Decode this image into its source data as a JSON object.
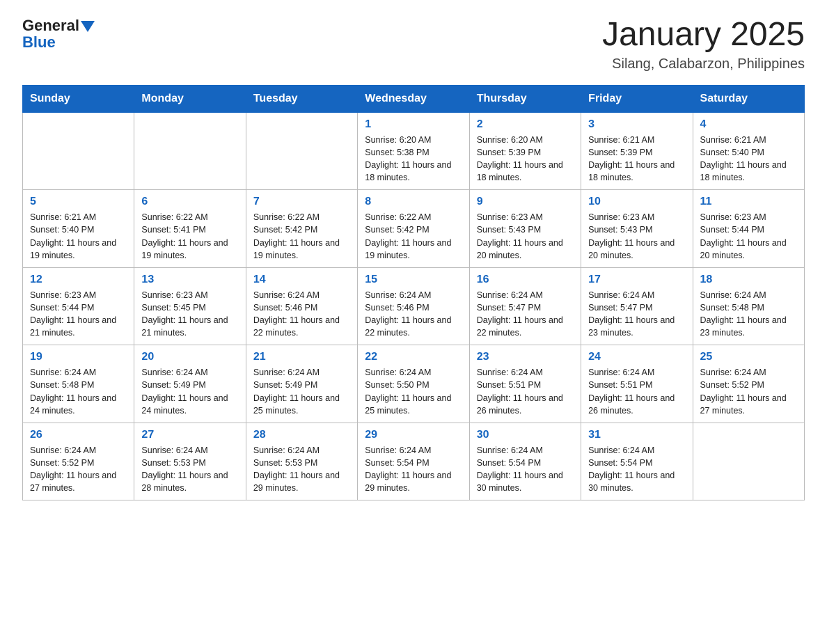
{
  "header": {
    "title": "January 2025",
    "subtitle": "Silang, Calabarzon, Philippines",
    "logo_general": "General",
    "logo_blue": "Blue"
  },
  "days_of_week": [
    "Sunday",
    "Monday",
    "Tuesday",
    "Wednesday",
    "Thursday",
    "Friday",
    "Saturday"
  ],
  "weeks": [
    [
      {
        "day": "",
        "sunrise": "",
        "sunset": "",
        "daylight": ""
      },
      {
        "day": "",
        "sunrise": "",
        "sunset": "",
        "daylight": ""
      },
      {
        "day": "",
        "sunrise": "",
        "sunset": "",
        "daylight": ""
      },
      {
        "day": "1",
        "sunrise": "Sunrise: 6:20 AM",
        "sunset": "Sunset: 5:38 PM",
        "daylight": "Daylight: 11 hours and 18 minutes."
      },
      {
        "day": "2",
        "sunrise": "Sunrise: 6:20 AM",
        "sunset": "Sunset: 5:39 PM",
        "daylight": "Daylight: 11 hours and 18 minutes."
      },
      {
        "day": "3",
        "sunrise": "Sunrise: 6:21 AM",
        "sunset": "Sunset: 5:39 PM",
        "daylight": "Daylight: 11 hours and 18 minutes."
      },
      {
        "day": "4",
        "sunrise": "Sunrise: 6:21 AM",
        "sunset": "Sunset: 5:40 PM",
        "daylight": "Daylight: 11 hours and 18 minutes."
      }
    ],
    [
      {
        "day": "5",
        "sunrise": "Sunrise: 6:21 AM",
        "sunset": "Sunset: 5:40 PM",
        "daylight": "Daylight: 11 hours and 19 minutes."
      },
      {
        "day": "6",
        "sunrise": "Sunrise: 6:22 AM",
        "sunset": "Sunset: 5:41 PM",
        "daylight": "Daylight: 11 hours and 19 minutes."
      },
      {
        "day": "7",
        "sunrise": "Sunrise: 6:22 AM",
        "sunset": "Sunset: 5:42 PM",
        "daylight": "Daylight: 11 hours and 19 minutes."
      },
      {
        "day": "8",
        "sunrise": "Sunrise: 6:22 AM",
        "sunset": "Sunset: 5:42 PM",
        "daylight": "Daylight: 11 hours and 19 minutes."
      },
      {
        "day": "9",
        "sunrise": "Sunrise: 6:23 AM",
        "sunset": "Sunset: 5:43 PM",
        "daylight": "Daylight: 11 hours and 20 minutes."
      },
      {
        "day": "10",
        "sunrise": "Sunrise: 6:23 AM",
        "sunset": "Sunset: 5:43 PM",
        "daylight": "Daylight: 11 hours and 20 minutes."
      },
      {
        "day": "11",
        "sunrise": "Sunrise: 6:23 AM",
        "sunset": "Sunset: 5:44 PM",
        "daylight": "Daylight: 11 hours and 20 minutes."
      }
    ],
    [
      {
        "day": "12",
        "sunrise": "Sunrise: 6:23 AM",
        "sunset": "Sunset: 5:44 PM",
        "daylight": "Daylight: 11 hours and 21 minutes."
      },
      {
        "day": "13",
        "sunrise": "Sunrise: 6:23 AM",
        "sunset": "Sunset: 5:45 PM",
        "daylight": "Daylight: 11 hours and 21 minutes."
      },
      {
        "day": "14",
        "sunrise": "Sunrise: 6:24 AM",
        "sunset": "Sunset: 5:46 PM",
        "daylight": "Daylight: 11 hours and 22 minutes."
      },
      {
        "day": "15",
        "sunrise": "Sunrise: 6:24 AM",
        "sunset": "Sunset: 5:46 PM",
        "daylight": "Daylight: 11 hours and 22 minutes."
      },
      {
        "day": "16",
        "sunrise": "Sunrise: 6:24 AM",
        "sunset": "Sunset: 5:47 PM",
        "daylight": "Daylight: 11 hours and 22 minutes."
      },
      {
        "day": "17",
        "sunrise": "Sunrise: 6:24 AM",
        "sunset": "Sunset: 5:47 PM",
        "daylight": "Daylight: 11 hours and 23 minutes."
      },
      {
        "day": "18",
        "sunrise": "Sunrise: 6:24 AM",
        "sunset": "Sunset: 5:48 PM",
        "daylight": "Daylight: 11 hours and 23 minutes."
      }
    ],
    [
      {
        "day": "19",
        "sunrise": "Sunrise: 6:24 AM",
        "sunset": "Sunset: 5:48 PM",
        "daylight": "Daylight: 11 hours and 24 minutes."
      },
      {
        "day": "20",
        "sunrise": "Sunrise: 6:24 AM",
        "sunset": "Sunset: 5:49 PM",
        "daylight": "Daylight: 11 hours and 24 minutes."
      },
      {
        "day": "21",
        "sunrise": "Sunrise: 6:24 AM",
        "sunset": "Sunset: 5:49 PM",
        "daylight": "Daylight: 11 hours and 25 minutes."
      },
      {
        "day": "22",
        "sunrise": "Sunrise: 6:24 AM",
        "sunset": "Sunset: 5:50 PM",
        "daylight": "Daylight: 11 hours and 25 minutes."
      },
      {
        "day": "23",
        "sunrise": "Sunrise: 6:24 AM",
        "sunset": "Sunset: 5:51 PM",
        "daylight": "Daylight: 11 hours and 26 minutes."
      },
      {
        "day": "24",
        "sunrise": "Sunrise: 6:24 AM",
        "sunset": "Sunset: 5:51 PM",
        "daylight": "Daylight: 11 hours and 26 minutes."
      },
      {
        "day": "25",
        "sunrise": "Sunrise: 6:24 AM",
        "sunset": "Sunset: 5:52 PM",
        "daylight": "Daylight: 11 hours and 27 minutes."
      }
    ],
    [
      {
        "day": "26",
        "sunrise": "Sunrise: 6:24 AM",
        "sunset": "Sunset: 5:52 PM",
        "daylight": "Daylight: 11 hours and 27 minutes."
      },
      {
        "day": "27",
        "sunrise": "Sunrise: 6:24 AM",
        "sunset": "Sunset: 5:53 PM",
        "daylight": "Daylight: 11 hours and 28 minutes."
      },
      {
        "day": "28",
        "sunrise": "Sunrise: 6:24 AM",
        "sunset": "Sunset: 5:53 PM",
        "daylight": "Daylight: 11 hours and 29 minutes."
      },
      {
        "day": "29",
        "sunrise": "Sunrise: 6:24 AM",
        "sunset": "Sunset: 5:54 PM",
        "daylight": "Daylight: 11 hours and 29 minutes."
      },
      {
        "day": "30",
        "sunrise": "Sunrise: 6:24 AM",
        "sunset": "Sunset: 5:54 PM",
        "daylight": "Daylight: 11 hours and 30 minutes."
      },
      {
        "day": "31",
        "sunrise": "Sunrise: 6:24 AM",
        "sunset": "Sunset: 5:54 PM",
        "daylight": "Daylight: 11 hours and 30 minutes."
      },
      {
        "day": "",
        "sunrise": "",
        "sunset": "",
        "daylight": ""
      }
    ]
  ]
}
